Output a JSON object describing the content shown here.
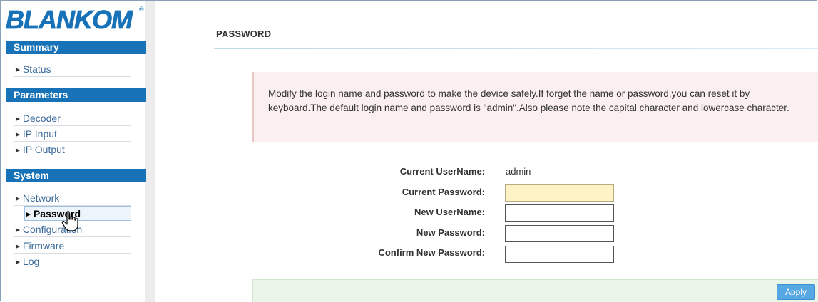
{
  "brand": {
    "logo_text": "BLANKOM",
    "registered_mark": "®"
  },
  "sidebar": {
    "sections": [
      {
        "title": "Summary",
        "items": [
          {
            "label": "Status"
          }
        ]
      },
      {
        "title": "Parameters",
        "items": [
          {
            "label": "Decoder"
          },
          {
            "label": "IP Input"
          },
          {
            "label": "IP Output"
          }
        ]
      },
      {
        "title": "System",
        "items": [
          {
            "label": "Network"
          },
          {
            "label": "Password"
          },
          {
            "label": "Configuration"
          },
          {
            "label": "Firmware"
          },
          {
            "label": "Log"
          }
        ]
      }
    ],
    "active_item": "Password",
    "arrow_glyph": "►"
  },
  "main": {
    "title": "PASSWORD",
    "notice": "Modify the login name and password to make the device safely.If forget the name or password,you can reset it by keyboard.The default login name and password is \"admin\".Also please note the capital character and lowercase character.",
    "form": {
      "current_username_label": "Current UserName:",
      "current_username_value": "admin",
      "current_password_label": "Current Password:",
      "current_password_value": "",
      "new_username_label": "New UserName:",
      "new_username_value": "",
      "new_password_label": "New Password:",
      "new_password_value": "",
      "confirm_password_label": "Confirm New Password:",
      "confirm_password_value": ""
    },
    "apply_label": "Apply"
  },
  "colors": {
    "brand_blue": "#1872b8",
    "section_header": "#1872b8",
    "notice_bg": "#fbf0ef",
    "footer_bg": "#eaf4e8",
    "apply_button": "#56a8e4",
    "focused_input": "#fdf3c7"
  }
}
